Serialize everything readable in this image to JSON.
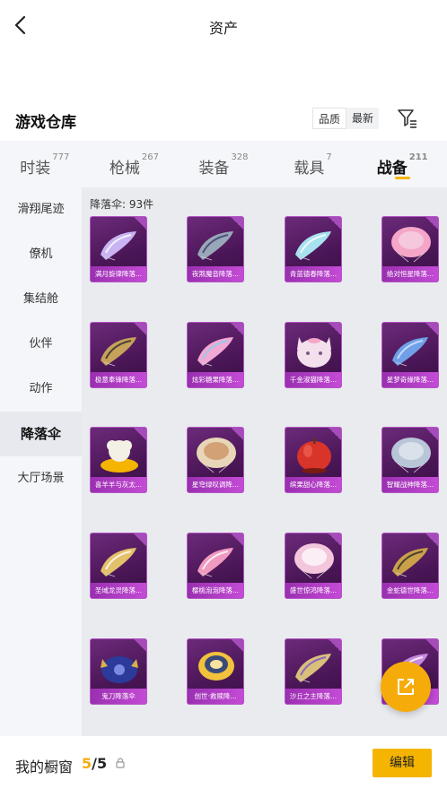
{
  "topbar": {
    "title": "资产"
  },
  "warehouse": {
    "title": "游戏仓库",
    "sort_options": [
      "品质",
      "最新"
    ],
    "sort_selected": "品质"
  },
  "tabs": [
    {
      "label": "时装",
      "count": "777"
    },
    {
      "label": "枪械",
      "count": "267"
    },
    {
      "label": "装备",
      "count": "328"
    },
    {
      "label": "载具",
      "count": "7"
    },
    {
      "label": "战备",
      "count": "211",
      "active": true
    }
  ],
  "sidebar": [
    {
      "label": "滑翔尾迹"
    },
    {
      "label": "僚机"
    },
    {
      "label": "集结舱"
    },
    {
      "label": "伙伴"
    },
    {
      "label": "动作"
    },
    {
      "label": "降落伞",
      "active": true
    },
    {
      "label": "大厅场景"
    }
  ],
  "main": {
    "count_label": "降落伞: 93件",
    "items": [
      {
        "name": "满月旋律降落...",
        "art": "folded",
        "color": "#c9b3f2",
        "accent": "#ffffff"
      },
      {
        "name": "夜煞魔音降落...",
        "art": "folded",
        "color": "#9aa7b8",
        "accent": "#3b3f6b"
      },
      {
        "name": "青蓝德春降落...",
        "art": "folded",
        "color": "#a8e2ef",
        "accent": "#ffffff"
      },
      {
        "name": "绝对恒星降落...",
        "art": "round",
        "color": "#f5a6c8",
        "accent": "#f7d7e6"
      },
      {
        "name": "极意奉锋降落...",
        "art": "folded",
        "color": "#c7a25a",
        "accent": "#2a2a2a"
      },
      {
        "name": "炫彩糖果降落...",
        "art": "folded",
        "color": "#f2a8d4",
        "accent": "#7fd3f0"
      },
      {
        "name": "千金淑猫降落...",
        "art": "cat",
        "color": "#f3e0ec",
        "accent": "#f5a6c8"
      },
      {
        "name": "星梦奇缘降落...",
        "art": "folded",
        "color": "#6fa0e8",
        "accent": "#dfe9ff"
      },
      {
        "name": "喜羊羊与灰太...",
        "art": "sheep",
        "color": "#f3f0e6",
        "accent": "#f5b400"
      },
      {
        "name": "星穹绿叹调降...",
        "art": "round",
        "color": "#e8d6b8",
        "accent": "#c98a58"
      },
      {
        "name": "缤果甜心降落...",
        "art": "apple",
        "color": "#d8342a",
        "accent": "#7a1a14"
      },
      {
        "name": "智耀战神降落...",
        "art": "round",
        "color": "#b8c6d8",
        "accent": "#e8ecf2"
      },
      {
        "name": "圣域龙灵降落...",
        "art": "folded",
        "color": "#e3c06a",
        "accent": "#ffffff"
      },
      {
        "name": "樱桃泡泡降落...",
        "art": "folded",
        "color": "#f09ac0",
        "accent": "#ffffff"
      },
      {
        "name": "盛世惊鸿降落...",
        "art": "round",
        "color": "#f3c6dc",
        "accent": "#ffffff"
      },
      {
        "name": "金蛇德世降落...",
        "art": "folded",
        "color": "#caa04a",
        "accent": "#2a2a2a"
      },
      {
        "name": "鬼刀降落伞",
        "art": "demon",
        "color": "#2c3a9a",
        "accent": "#d9b04a"
      },
      {
        "name": "创世·救赎降...",
        "art": "disc",
        "color": "#f2c23c",
        "accent": "#3a4a7a"
      },
      {
        "name": "沙丘之主降落...",
        "art": "folded",
        "color": "#d8c07a",
        "accent": "#7c4fd0"
      },
      {
        "name": "",
        "art": "folded",
        "color": "#c88adf",
        "accent": "#ffffff"
      }
    ]
  },
  "bottom": {
    "label": "我的橱窗",
    "used": "5",
    "total": "/5",
    "edit_label": "编辑"
  },
  "colors": {
    "accent": "#f5b400",
    "card_border": "#b455c4",
    "card_bg": "#4a1656"
  }
}
